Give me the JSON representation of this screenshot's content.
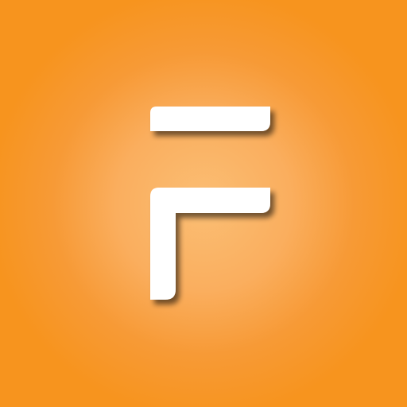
{
  "app_icon": {
    "icon_name": "f-letter-logo-icon",
    "colors": {
      "background": "#F7941E",
      "background_glow": "#FBBE74",
      "glyph": "#FFFFFF",
      "shadow": "#3A2000"
    }
  }
}
